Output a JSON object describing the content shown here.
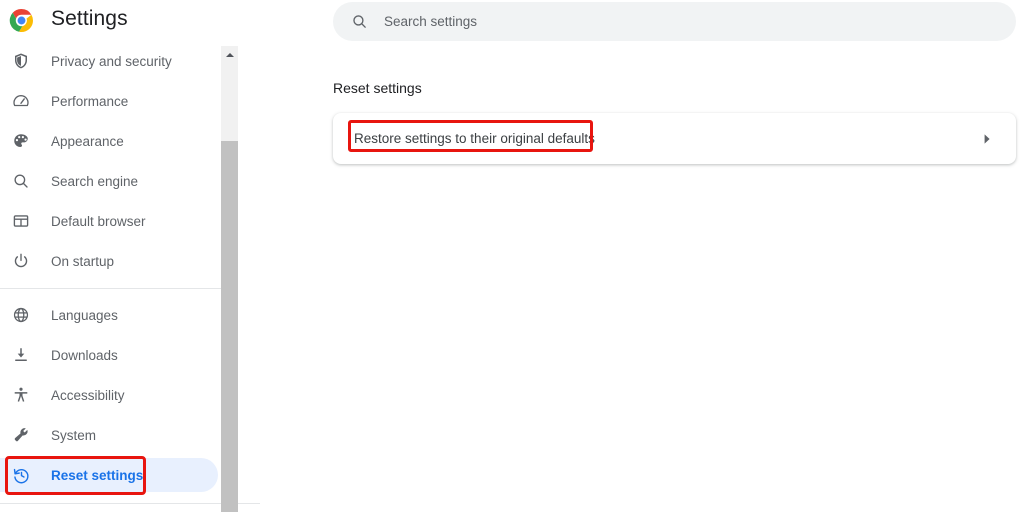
{
  "app": {
    "title": "Settings",
    "logo_icon": "chrome-logo-icon",
    "accent_color": "#1a73e8",
    "selected_pill_color": "#e8f0fe",
    "annotation_color": "#e8150f"
  },
  "search": {
    "placeholder": "Search settings",
    "value": "",
    "icon": "search-icon"
  },
  "sidebar": {
    "groups": [
      {
        "items": [
          {
            "label": "Privacy and security",
            "icon": "shield-icon",
            "selected": false
          },
          {
            "label": "Performance",
            "icon": "speedometer-icon",
            "selected": false
          },
          {
            "label": "Appearance",
            "icon": "palette-icon",
            "selected": false
          },
          {
            "label": "Search engine",
            "icon": "search-icon",
            "selected": false
          },
          {
            "label": "Default browser",
            "icon": "browser-window-icon",
            "selected": false
          },
          {
            "label": "On startup",
            "icon": "power-icon",
            "selected": false
          }
        ]
      },
      {
        "items": [
          {
            "label": "Languages",
            "icon": "globe-icon",
            "selected": false
          },
          {
            "label": "Downloads",
            "icon": "download-icon",
            "selected": false
          },
          {
            "label": "Accessibility",
            "icon": "accessibility-icon",
            "selected": false
          },
          {
            "label": "System",
            "icon": "wrench-icon",
            "selected": false
          },
          {
            "label": "Reset settings",
            "icon": "restore-history-icon",
            "selected": true
          }
        ]
      }
    ]
  },
  "main": {
    "section_title": "Reset settings",
    "card": {
      "label": "Restore settings to their original defaults",
      "chevron_icon": "chevron-right-icon"
    }
  },
  "scrollbar": {
    "up_arrow_icon": "scroll-up-arrow-icon",
    "thumb_position_percent": 20
  },
  "annotations": [
    {
      "name": "annot-restore-defaults",
      "target": "Restore settings to their original defaults"
    },
    {
      "name": "annot-reset-settings-nav",
      "target": "Reset settings"
    }
  ]
}
